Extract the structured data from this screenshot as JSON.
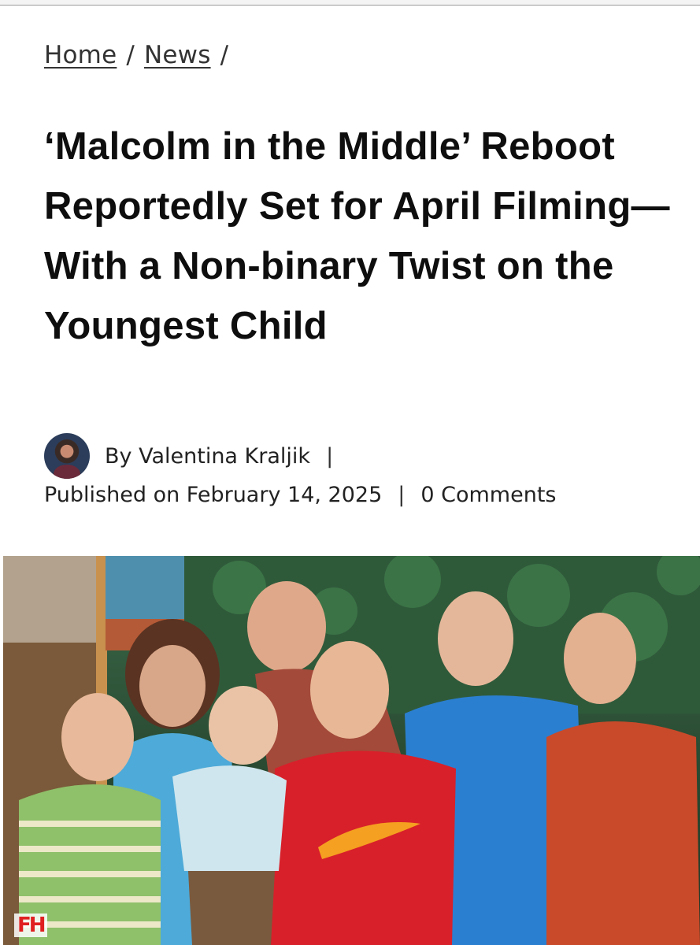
{
  "breadcrumb": {
    "home": "Home",
    "news": "News",
    "separator": "/"
  },
  "article": {
    "title": "‘Malcolm in the Middle’ Reboot Reportedly Set for April Filming—With a Non-binary Twist on the Youngest Child",
    "author_line": "By Valentina Kraljik",
    "published": "Published on February 14, 2025",
    "comments": "0 Comments",
    "pipe": "|"
  },
  "hero": {
    "logo_text": "FH"
  }
}
